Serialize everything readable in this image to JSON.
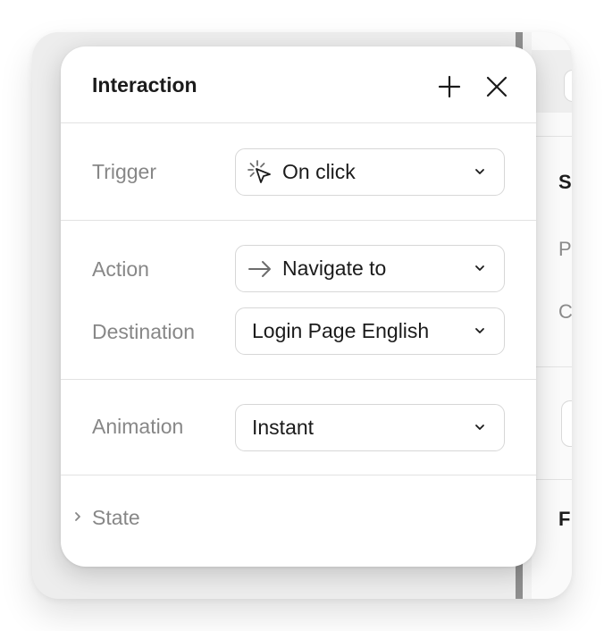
{
  "popover": {
    "title": "Interaction",
    "add_icon": "plus-icon",
    "close_icon": "close-icon"
  },
  "trigger": {
    "label": "Trigger",
    "value": "On click",
    "icon": "cursor-click-icon"
  },
  "action": {
    "label": "Action",
    "value": "Navigate to",
    "icon": "arrow-right-icon"
  },
  "destination": {
    "label": "Destination",
    "value": "Login Page English"
  },
  "animation": {
    "label": "Animation",
    "value": "Instant"
  },
  "state": {
    "label": "State",
    "icon": "chevron-right-icon"
  },
  "background_panel": {
    "letters": [
      "S",
      "P",
      "C",
      "F"
    ]
  },
  "colors": {
    "text_primary": "#1b1b1b",
    "text_secondary": "#878787",
    "border": "#d7d7d7",
    "divider_dark": "#8e8e8e"
  }
}
